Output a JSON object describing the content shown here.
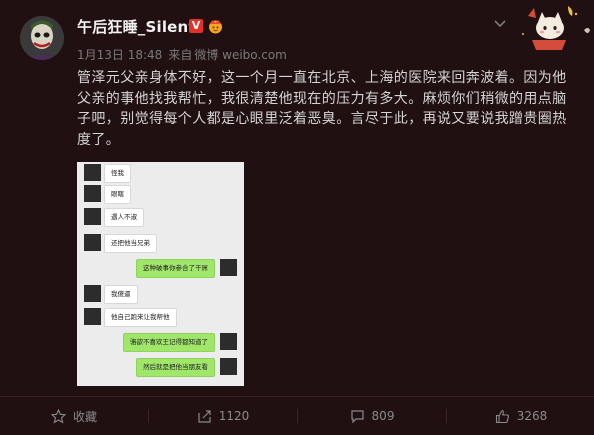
{
  "post": {
    "username": "午后狂睡_Silent",
    "verified_badge": "V",
    "date": "1月13日 18:48",
    "source_prefix": "来自",
    "source": "微博 weibo.com",
    "text": "管泽元父亲身体不好，这一个月一直在北京、上海的医院来回奔波着。因为他父亲的事他找我帮忙，我很清楚他现在的压力有多大。麻烦你们稍微的用点脑子吧，别觉得每个人都是心眼里泛着恶臭。言尽于此，再说又要说我蹭贵圈热度了。"
  },
  "chat": {
    "messages": [
      {
        "side": "left",
        "text": "怪我"
      },
      {
        "side": "left",
        "text": "眼瞎"
      },
      {
        "side": "left",
        "text": "遇人不淑"
      },
      {
        "side": "left",
        "text": "还把他当兄弟"
      },
      {
        "side": "right",
        "text": "这种破事你参合了干屌"
      },
      {
        "side": "left",
        "text": "我傻逼"
      },
      {
        "side": "left",
        "text": "他自己跑来让我帮他"
      },
      {
        "side": "right",
        "text": "骆歆不喜欢王记得都知道了"
      },
      {
        "side": "right",
        "text": "然后就是把他当朋友看"
      }
    ]
  },
  "actions": {
    "favorite": "收藏",
    "repost": "1120",
    "comment": "809",
    "like": "3268"
  },
  "colors": {
    "background": "#201011",
    "verified": "#e6302a",
    "chat_bubble_right": "#9fe66b"
  }
}
